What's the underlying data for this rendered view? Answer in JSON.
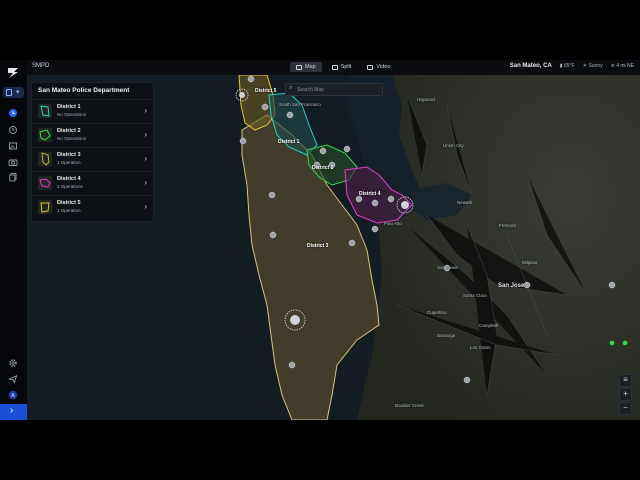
{
  "app": {
    "org": "SMPD"
  },
  "view_tabs": [
    {
      "label": "Map",
      "active": true
    },
    {
      "label": "Split",
      "active": false
    },
    {
      "label": "Video",
      "active": false
    }
  ],
  "status": {
    "location": "San Mateo, CA",
    "temperature": "65°F",
    "weather": "Sunny",
    "wind": "4 mi NE"
  },
  "search": {
    "placeholder": "Search Map"
  },
  "panel": {
    "title": "San Mateo Police Department",
    "districts": [
      {
        "name": "District 1",
        "operations": "No Operations",
        "color": "#2ecfc4"
      },
      {
        "name": "District 2",
        "operations": "No Operations",
        "color": "#3ed455"
      },
      {
        "name": "District 3",
        "operations": "1 Operation",
        "color": "#c9a94e"
      },
      {
        "name": "District 4",
        "operations": "2 Operations",
        "color": "#e23fd0"
      },
      {
        "name": "District 5",
        "operations": "1 Operation",
        "color": "#e8c640"
      }
    ]
  },
  "map_labels": {
    "d5": "District 5",
    "d1": "District 1",
    "d2": "District 2",
    "d4": "District 4",
    "d3": "District 3",
    "san_jose": "San Jose",
    "cities": [
      "Hayward",
      "Fremont",
      "Union City",
      "Milpitas",
      "Santa Clara",
      "Sunnyvale",
      "Palo Alto",
      "Cupertino",
      "Campbell",
      "Los Gatos",
      "Saratoga",
      "Boulder Creek",
      "South San Francisco",
      "Newark"
    ]
  },
  "map_controls": {
    "zoom_in": "+",
    "zoom_out": "−"
  }
}
